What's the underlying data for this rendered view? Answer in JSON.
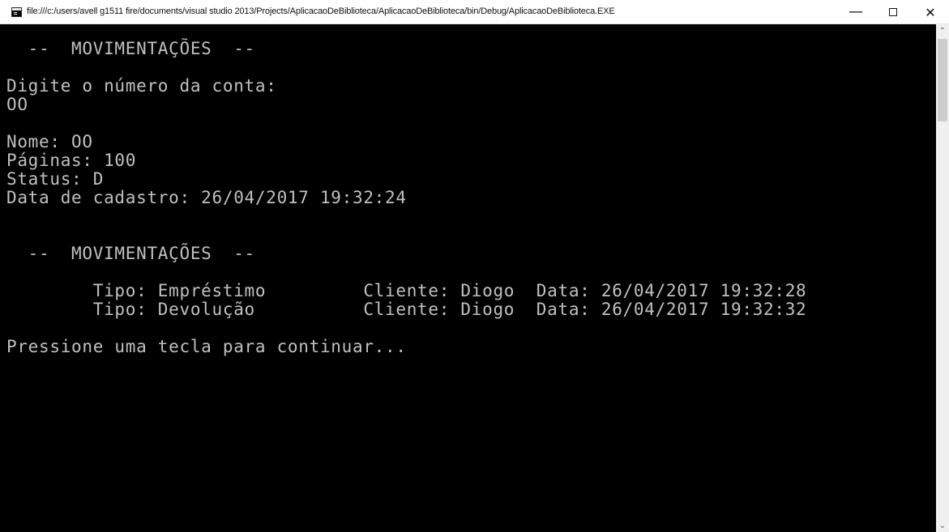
{
  "window": {
    "title": "file:///c:/users/avell g1511 fire/documents/visual studio 2013/Projects/AplicacaoDeBiblioteca/AplicacaoDeBiblioteca/bin/Debug/AplicacaoDeBiblioteca.EXE",
    "icon": "console-app-icon",
    "controls": {
      "minimize_symbol": "—",
      "maximize_icon": "maximize-icon",
      "close_symbol": "✕"
    }
  },
  "console": {
    "text": "  --  MOVIMENTAÇÕES  --\n\nDigite o número da conta:\nOO\n\nNome: OO\nPáginas: 100\nStatus: D\nData de cadastro: 26/04/2017 19:32:24\n\n\n  --  MOVIMENTAÇÕES  --\n\n        Tipo: Empréstimo         Cliente: Diogo  Data: 26/04/2017 19:32:28\n        Tipo: Devolução          Cliente: Diogo  Data: 26/04/2017 19:32:32\n\nPressione uma tecla para continuar..."
  },
  "scrollbar": {
    "up_symbol": "⌃",
    "down_symbol": "⌄"
  },
  "colors": {
    "console_background": "#000000",
    "console_text": "#c0c0c0",
    "titlebar_background": "#ffffff",
    "scrollbar_background": "#f0f0f0",
    "scrollbar_thumb": "#cdcdcd"
  }
}
